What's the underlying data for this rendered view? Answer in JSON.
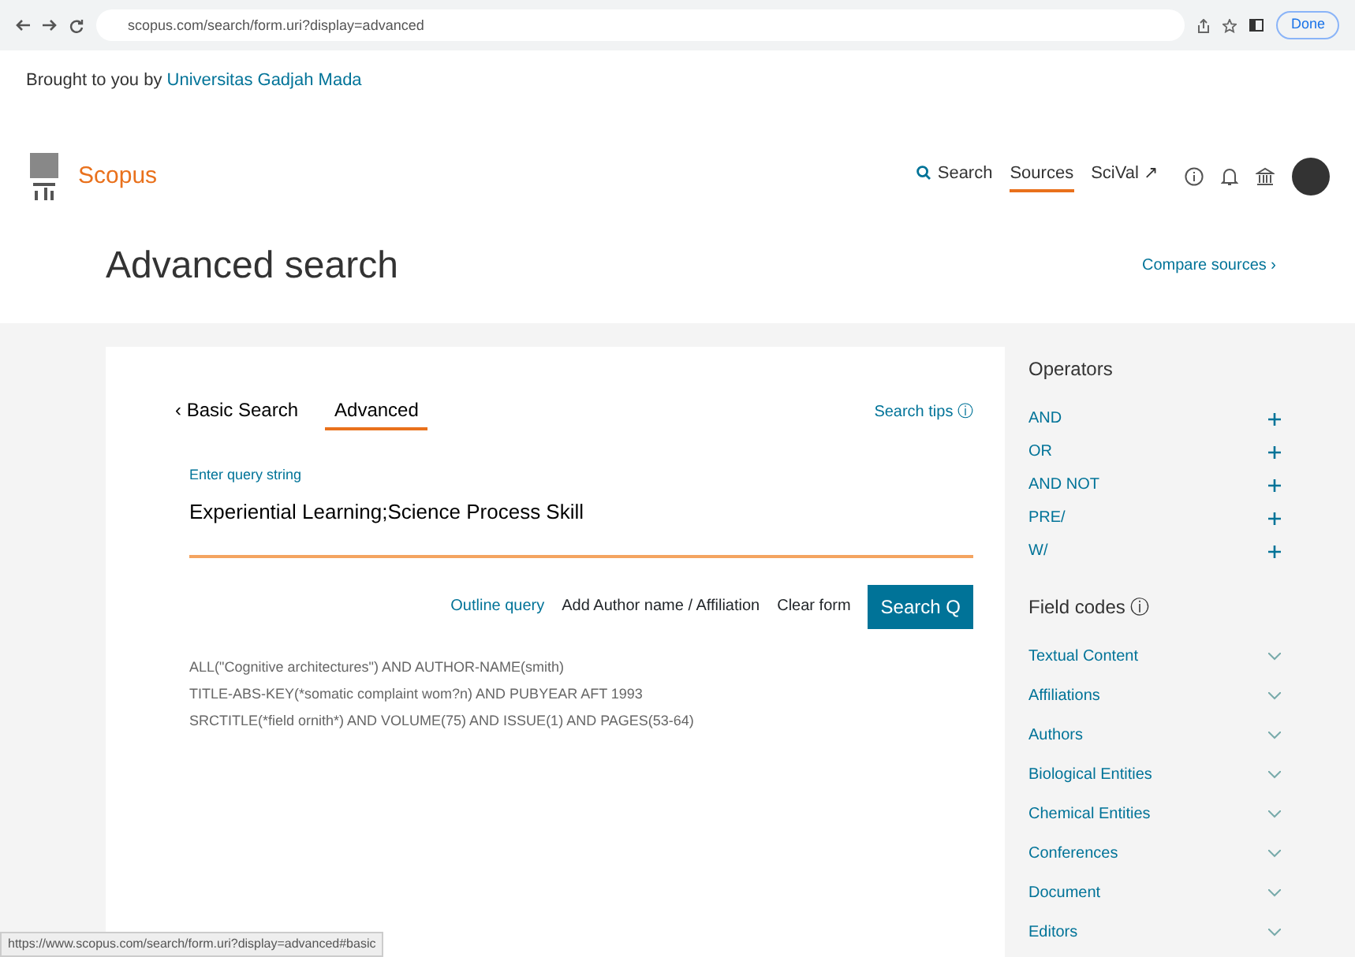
{
  "browser": {
    "url": "scopus.com/search/form.uri?display=advanced",
    "profile_label": "Done"
  },
  "banner": {
    "prefix": "Brought to you by",
    "institution": "Universitas Gadjah Mada"
  },
  "header": {
    "brand": "Scopus",
    "nav": [
      {
        "label": "Search",
        "selected": false,
        "kind": "search"
      },
      {
        "label": "Sources",
        "selected": true,
        "kind": "plain"
      },
      {
        "label": "SciVal ↗",
        "selected": false,
        "kind": "plain"
      }
    ]
  },
  "page_title": "Advanced search",
  "compare_link": "Compare sources ›",
  "tabs": [
    {
      "label": "‹ Basic Search",
      "selected": false
    },
    {
      "label": "Advanced",
      "selected": true
    }
  ],
  "search_tips": "Search tips ⓘ",
  "query": {
    "label": "Enter query string",
    "value": "Experiential Learning;Science Process Skill"
  },
  "actions": [
    {
      "label": "Outline query",
      "kind": "link"
    },
    {
      "label": "Add Author name / Affiliation",
      "kind": "plain"
    },
    {
      "label": "Clear form",
      "kind": "plain"
    },
    {
      "label": "Search Q",
      "kind": "primary"
    }
  ],
  "examples": [
    "ALL(\"Cognitive architectures\") AND AUTHOR-NAME(smith)",
    "TITLE-ABS-KEY(*somatic complaint wom?n) AND PUBYEAR AFT 1993",
    "SRCTITLE(*field ornith*) AND VOLUME(75) AND ISSUE(1) AND PAGES(53-64)"
  ],
  "operators": {
    "title": "Operators",
    "items": [
      "AND",
      "OR",
      "AND NOT",
      "PRE/",
      "W/"
    ]
  },
  "field_codes": {
    "title": "Field codes ⓘ",
    "items": [
      "Textual Content",
      "Affiliations",
      "Authors",
      "Biological Entities",
      "Chemical Entities",
      "Conferences",
      "Document",
      "Editors"
    ]
  },
  "status_bar": "https://www.scopus.com/search/form.uri?display=advanced#basic"
}
